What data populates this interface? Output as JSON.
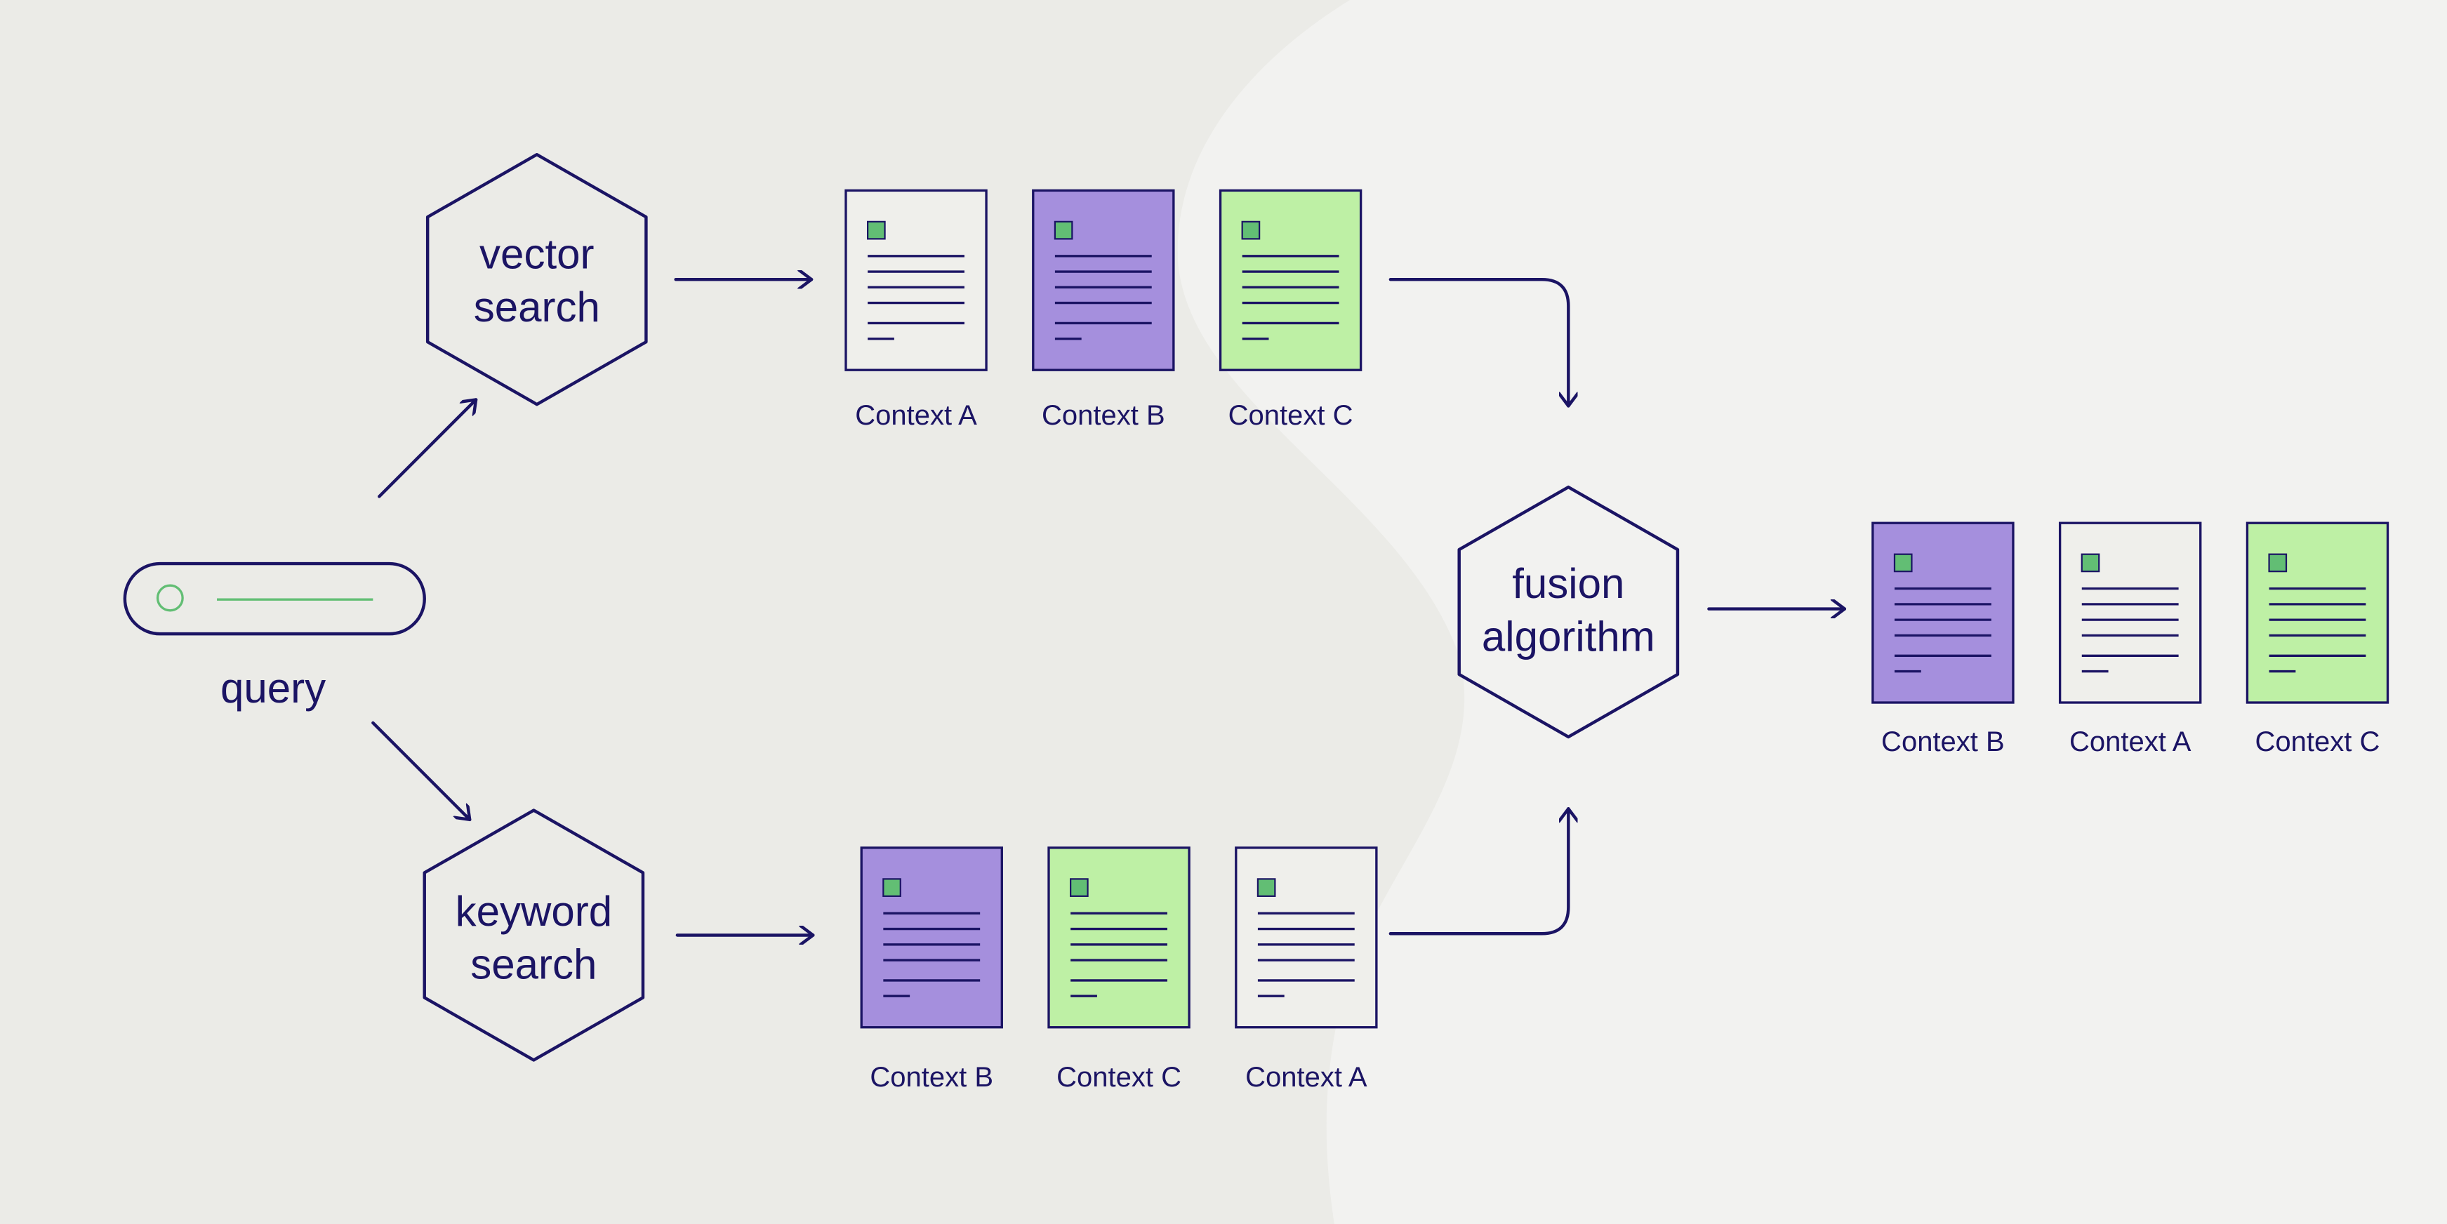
{
  "colors": {
    "background": "#EBEBE7",
    "background_light": "#F2F2F0",
    "ink": "#1B1464",
    "purple_doc": "#A58FDD",
    "green_doc": "#BEF0A5",
    "white_doc": "#EFEFEB",
    "accent_green": "#62BE74"
  },
  "query": {
    "label": "query"
  },
  "nodes": {
    "vector": {
      "line1": "vector",
      "line2": "search"
    },
    "keyword": {
      "line1": "keyword",
      "line2": "search"
    },
    "fusion": {
      "line1": "fusion",
      "line2": "algorithm"
    }
  },
  "vector_results": [
    {
      "label": "Context A",
      "color": "white"
    },
    {
      "label": "Context B",
      "color": "purple"
    },
    {
      "label": "Context C",
      "color": "green"
    }
  ],
  "keyword_results": [
    {
      "label": "Context B",
      "color": "purple"
    },
    {
      "label": "Context C",
      "color": "green"
    },
    {
      "label": "Context A",
      "color": "white"
    }
  ],
  "fused_results": [
    {
      "label": "Context B",
      "color": "purple"
    },
    {
      "label": "Context A",
      "color": "white"
    },
    {
      "label": "Context C",
      "color": "green"
    }
  ]
}
